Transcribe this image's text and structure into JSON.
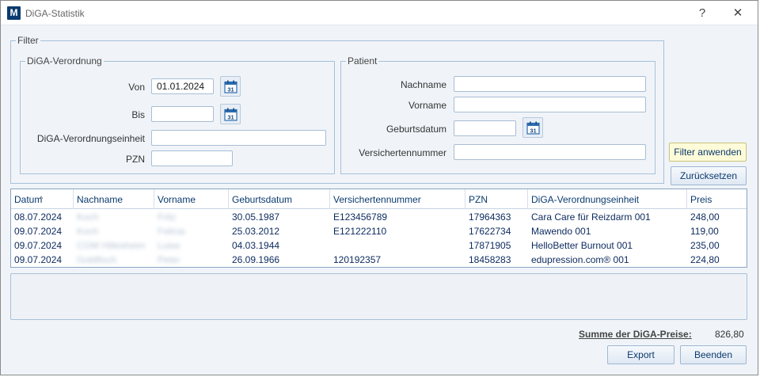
{
  "window": {
    "title": "DiGA-Statistik",
    "icon_letter": "M",
    "help": "?",
    "close": "✕"
  },
  "filter": {
    "legend": "Filter",
    "verordnung": {
      "legend": "DiGA-Verordnung",
      "von_label": "Von",
      "von_value": "01.01.2024",
      "bis_label": "Bis",
      "bis_value": "",
      "einheit_label": "DiGA-Verordnungseinheit",
      "einheit_value": "",
      "pzn_label": "PZN",
      "pzn_value": ""
    },
    "patient": {
      "legend": "Patient",
      "nachname_label": "Nachname",
      "nachname_value": "",
      "vorname_label": "Vorname",
      "vorname_value": "",
      "geburtsdatum_label": "Geburtsdatum",
      "geburtsdatum_value": "",
      "versicherten_label": "Versichertennummer",
      "versicherten_value": ""
    },
    "calendar_day": "31",
    "apply_label": "Filter anwenden",
    "reset_label": "Zurücksetzen"
  },
  "table": {
    "columns": [
      "Datum",
      "Nachname",
      "Vorname",
      "Geburtsdatum",
      "Versichertennummer",
      "PZN",
      "DiGA-Verordnungseinheit",
      "Preis"
    ],
    "sort_indicator": "^",
    "rows": [
      [
        "08.07.2024",
        "Koch",
        "Fritz",
        "30.05.1987",
        "E123456789",
        "17964363",
        "Cara Care für Reizdarm 001",
        "248,00"
      ],
      [
        "09.07.2024",
        "Koch",
        "Felicia",
        "25.03.2012",
        "E121222110",
        "17622734",
        "Mawendo 001",
        "119,00"
      ],
      [
        "09.07.2024",
        "CGM Hillesheim",
        "Luise",
        "04.03.1944",
        "",
        "17871905",
        "HelloBetter Burnout 001",
        "235,00"
      ],
      [
        "09.07.2024",
        "Goldfisch",
        "Peter",
        "26.09.1966",
        "120192357",
        "18458283",
        "edupression.com® 001",
        "224,80"
      ]
    ]
  },
  "summary": {
    "label": "Summe der DiGA-Preise:",
    "value": "826,80"
  },
  "footer": {
    "export_label": "Export",
    "close_label": "Beenden"
  }
}
